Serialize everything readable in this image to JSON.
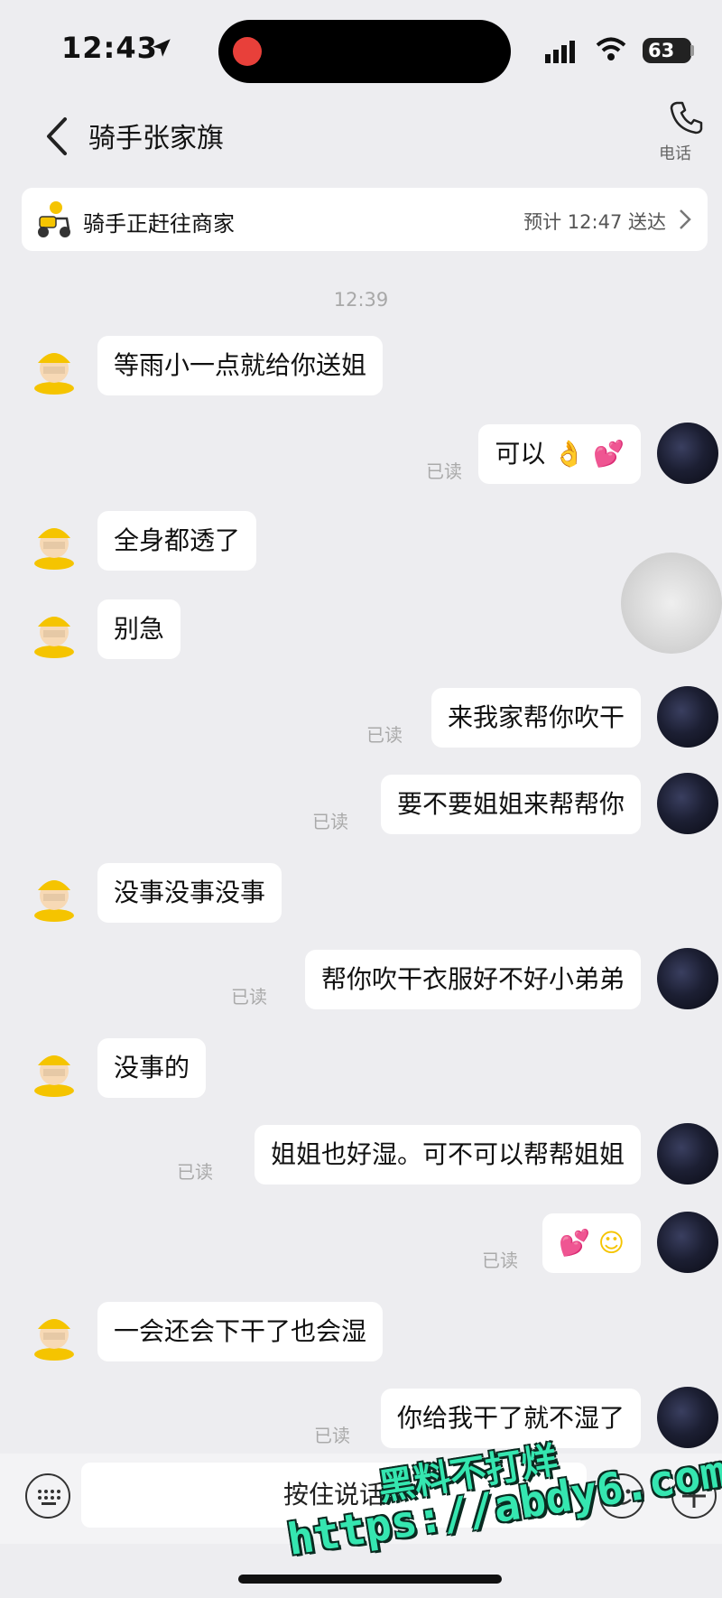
{
  "status_bar": {
    "time": "12:43",
    "battery": "63"
  },
  "header": {
    "title": "骑手张家旗",
    "phone_label": "电话"
  },
  "banner": {
    "status": "骑手正赶往商家",
    "eta": "预计 12:47 送达"
  },
  "timestamp": "12:39",
  "messages": [
    {
      "side": "left",
      "text": "等雨小一点就给你送姐"
    },
    {
      "side": "right",
      "text": "可以",
      "emoji": [
        "ok-hand",
        "two-hearts"
      ],
      "read": "已读"
    },
    {
      "side": "left",
      "text": "全身都透了"
    },
    {
      "side": "left",
      "text": "别急"
    },
    {
      "side": "right",
      "text": "来我家帮你吹干",
      "read": "已读"
    },
    {
      "side": "right",
      "text": "要不要姐姐来帮帮你",
      "read": "已读"
    },
    {
      "side": "left",
      "text": "没事没事没事"
    },
    {
      "side": "right",
      "text": "帮你吹干衣服好不好小弟弟",
      "read": "已读"
    },
    {
      "side": "left",
      "text": "没事的"
    },
    {
      "side": "right",
      "text": "姐姐也好湿。可不可以帮帮姐姐",
      "read": "已读"
    },
    {
      "side": "right",
      "text": "",
      "emoji": [
        "two-hearts",
        "smiling-face"
      ],
      "read": "已读"
    },
    {
      "side": "left",
      "text": "一会还会下干了也会湿"
    },
    {
      "side": "right",
      "text": "你给我干了就不湿了",
      "read": "已读"
    }
  ],
  "input_bar": {
    "hold_to_talk": "按住说话"
  },
  "watermark": {
    "line1": "黑料不打烊",
    "line2": "https://abdy6.com"
  },
  "colors": {
    "background": "#ededf0",
    "bubble": "#ffffff",
    "read_text": "#aaaaaa",
    "watermark": "#35e6b0"
  }
}
